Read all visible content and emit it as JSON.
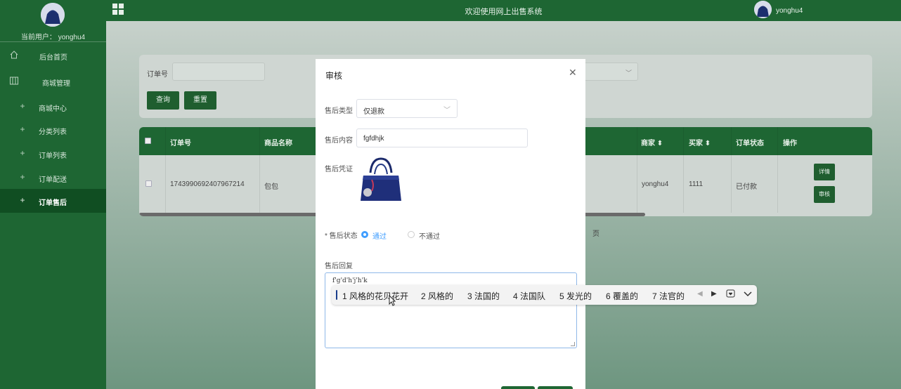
{
  "sidebar": {
    "current_user_label": "当前用户：",
    "current_user": "yonghu4",
    "items": [
      {
        "label": "后台首页",
        "icon": "home-icon"
      },
      {
        "label": "商城管理",
        "icon": "columns-icon"
      },
      {
        "label": "商城中心",
        "icon": "plus-icon"
      },
      {
        "label": "分类列表",
        "icon": "plus-icon"
      },
      {
        "label": "订单列表",
        "icon": "plus-icon"
      },
      {
        "label": "订单配送",
        "icon": "plus-icon"
      },
      {
        "label": "订单售后",
        "icon": "plus-icon"
      }
    ]
  },
  "header": {
    "title": "欢迎使用网上出售系统",
    "username": "yonghu4"
  },
  "search": {
    "order_label": "订单号",
    "query_button": "查询",
    "reset_button": "重置"
  },
  "table": {
    "headers": [
      "订单号",
      "商品名称",
      "商家 ⬍",
      "买家 ⬍",
      "订单状态",
      "操作"
    ],
    "row": {
      "order_no": "1743990692407967214",
      "product": "包包",
      "merchant": "yonghu4",
      "buyer": "1111",
      "status": "已付款"
    },
    "detail_button": "详情",
    "review_button": "审核",
    "page_suffix": "页"
  },
  "modal": {
    "title": "审核",
    "type_label": "售后类型",
    "type_value": "仅退款",
    "content_label": "售后内容",
    "content_value": "fgfdhjk",
    "proof_label": "售后凭证",
    "status_label": "* 售后状态",
    "status_options": [
      "通过",
      "不通过"
    ],
    "status_selected": "通过",
    "reply_label": "售后回复",
    "reply_value": "f'g'd'h'j'h'k"
  },
  "ime": {
    "candidates": [
      "1 风格的花贝花开",
      "2 风格的",
      "3 法国的",
      "4 法国队",
      "5 发光的",
      "6 覆盖的",
      "7 法官的"
    ]
  },
  "colors": {
    "primary_green": "#1e6633",
    "accent_blue": "#409eff"
  }
}
